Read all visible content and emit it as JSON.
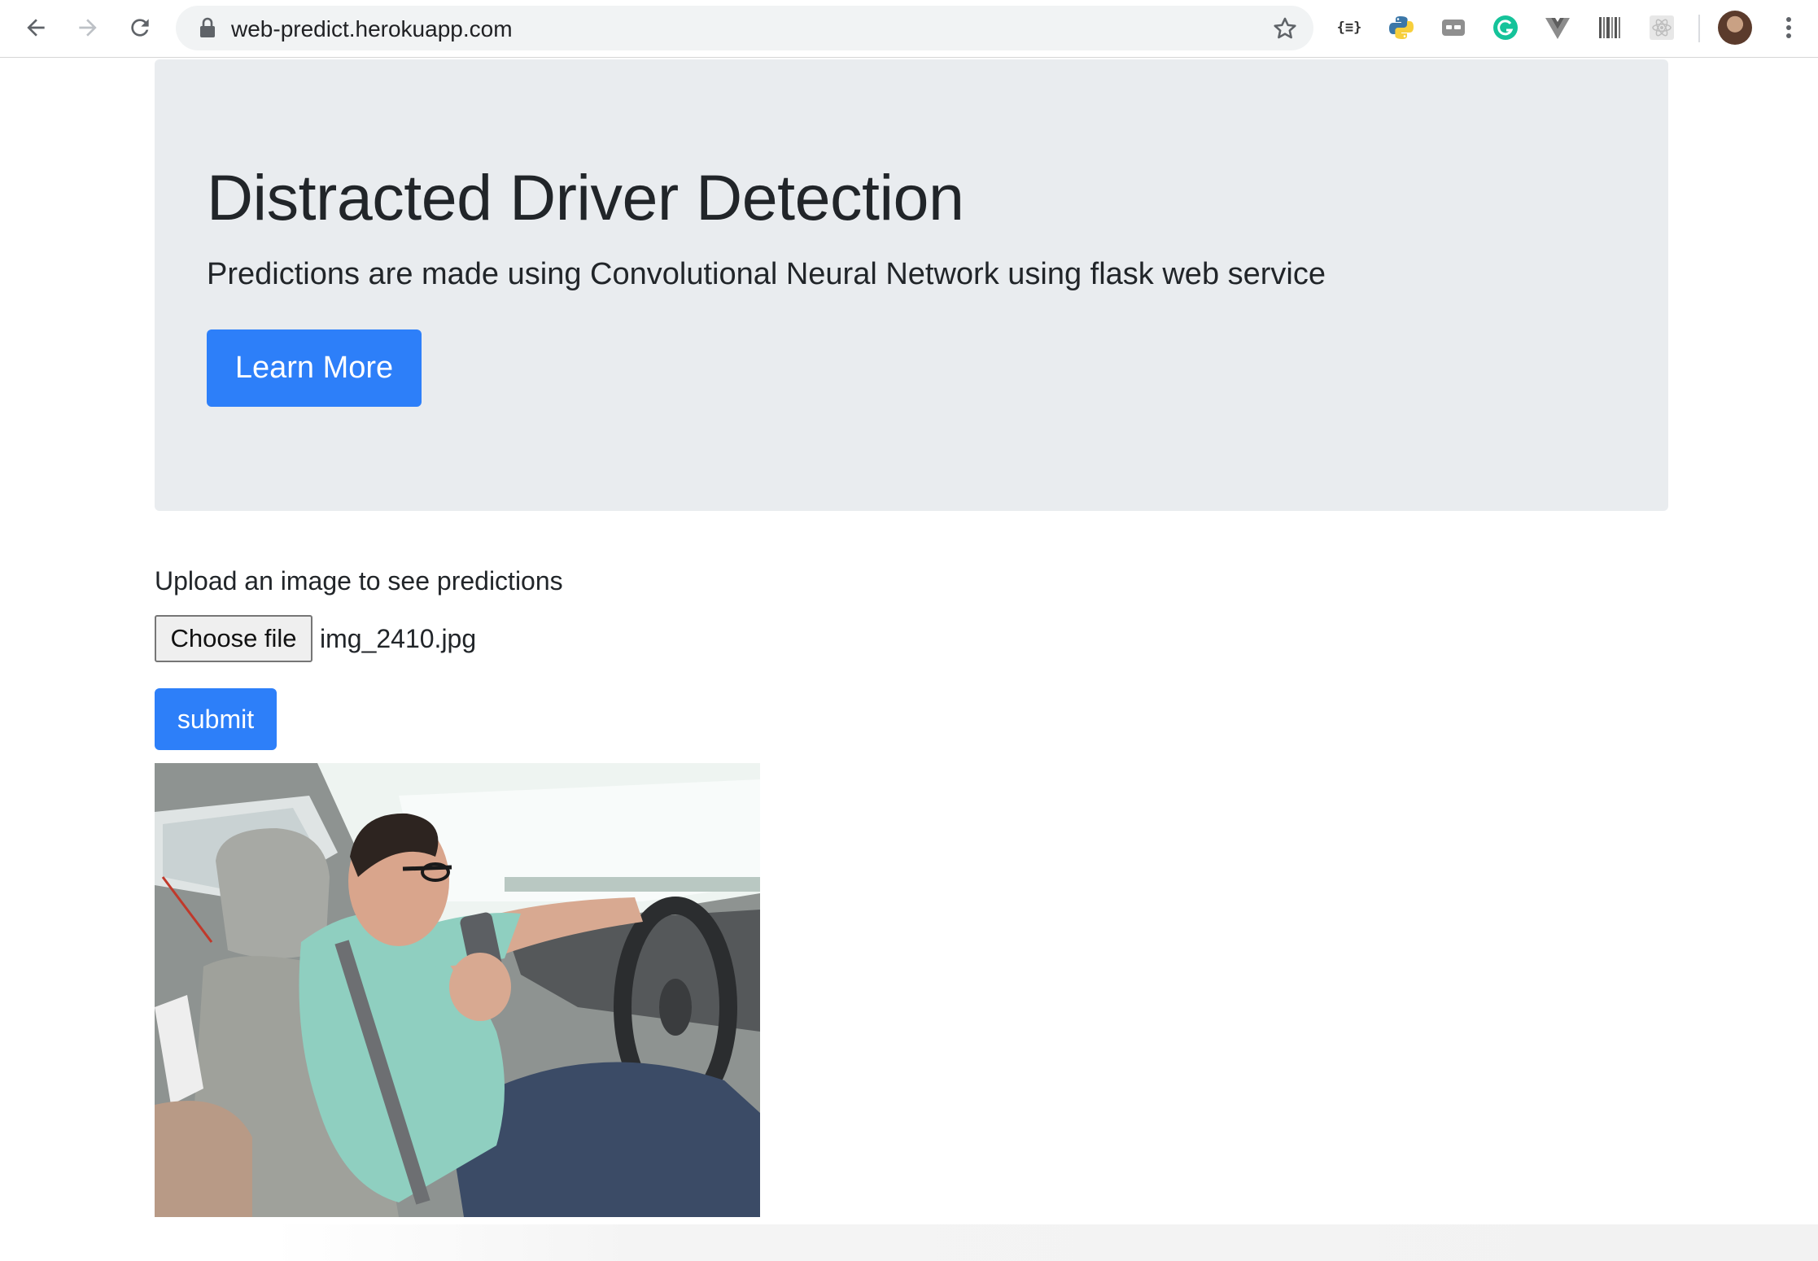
{
  "browser": {
    "url": "web-predict.herokuapp.com",
    "toolbar_icons": [
      "back-icon",
      "forward-icon",
      "reload-icon",
      "lock-icon",
      "bookmark-star-icon"
    ],
    "extensions": [
      {
        "name": "json-formatter-icon",
        "label": "{≡}"
      },
      {
        "name": "python-icon"
      },
      {
        "name": "caption-icon"
      },
      {
        "name": "grammarly-icon",
        "color": "#15c39a"
      },
      {
        "name": "vue-icon"
      },
      {
        "name": "barcode-icon"
      },
      {
        "name": "react-icon"
      }
    ],
    "profile": "avatar",
    "menu": "kebab-menu-icon"
  },
  "jumbotron": {
    "title": "Distracted Driver Detection",
    "lead": "Predictions are made using Convolutional Neural Network using flask web service",
    "button_label": "Learn More"
  },
  "upload": {
    "label": "Upload an image to see predictions",
    "choose_file_label": "Choose file",
    "file_name": "img_2410.jpg",
    "submit_label": "submit"
  },
  "colors": {
    "primary": "#2d7ff9",
    "jumbotron_bg": "#e9ecef",
    "text": "#212529"
  }
}
